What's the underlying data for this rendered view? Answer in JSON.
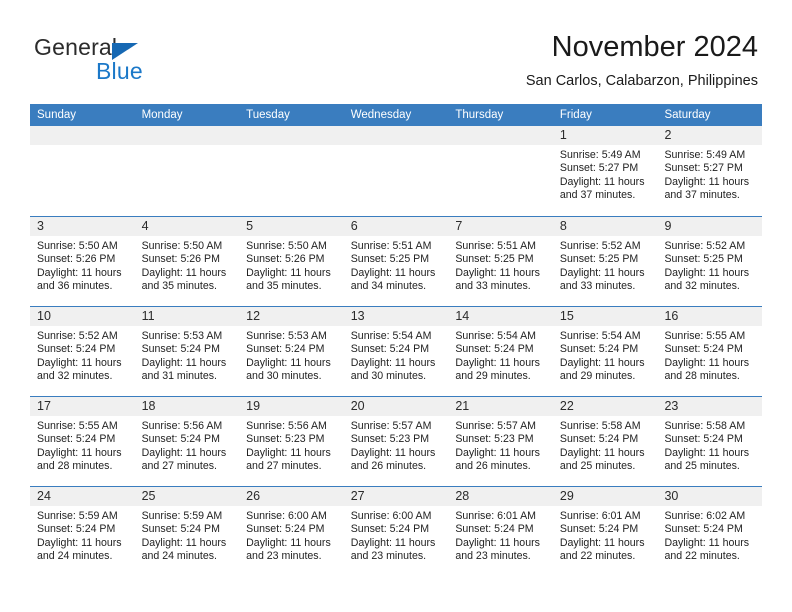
{
  "brand": {
    "name_top": "General",
    "name_bottom": "Blue",
    "accent_color": "#1b78c8",
    "triangle_color": "#1668b3"
  },
  "header": {
    "title": "November 2024",
    "subtitle": "San Carlos, Calabarzon, Philippines"
  },
  "calendar": {
    "header_bg": "#3a7dbf",
    "daynum_bg": "#f0f0f0",
    "weekdays": [
      "Sunday",
      "Monday",
      "Tuesday",
      "Wednesday",
      "Thursday",
      "Friday",
      "Saturday"
    ],
    "weeks": [
      [
        {
          "day": "",
          "sunrise": "",
          "sunset": "",
          "daylight": ""
        },
        {
          "day": "",
          "sunrise": "",
          "sunset": "",
          "daylight": ""
        },
        {
          "day": "",
          "sunrise": "",
          "sunset": "",
          "daylight": ""
        },
        {
          "day": "",
          "sunrise": "",
          "sunset": "",
          "daylight": ""
        },
        {
          "day": "",
          "sunrise": "",
          "sunset": "",
          "daylight": ""
        },
        {
          "day": "1",
          "sunrise": "Sunrise: 5:49 AM",
          "sunset": "Sunset: 5:27 PM",
          "daylight": "Daylight: 11 hours and 37 minutes."
        },
        {
          "day": "2",
          "sunrise": "Sunrise: 5:49 AM",
          "sunset": "Sunset: 5:27 PM",
          "daylight": "Daylight: 11 hours and 37 minutes."
        }
      ],
      [
        {
          "day": "3",
          "sunrise": "Sunrise: 5:50 AM",
          "sunset": "Sunset: 5:26 PM",
          "daylight": "Daylight: 11 hours and 36 minutes."
        },
        {
          "day": "4",
          "sunrise": "Sunrise: 5:50 AM",
          "sunset": "Sunset: 5:26 PM",
          "daylight": "Daylight: 11 hours and 35 minutes."
        },
        {
          "day": "5",
          "sunrise": "Sunrise: 5:50 AM",
          "sunset": "Sunset: 5:26 PM",
          "daylight": "Daylight: 11 hours and 35 minutes."
        },
        {
          "day": "6",
          "sunrise": "Sunrise: 5:51 AM",
          "sunset": "Sunset: 5:25 PM",
          "daylight": "Daylight: 11 hours and 34 minutes."
        },
        {
          "day": "7",
          "sunrise": "Sunrise: 5:51 AM",
          "sunset": "Sunset: 5:25 PM",
          "daylight": "Daylight: 11 hours and 33 minutes."
        },
        {
          "day": "8",
          "sunrise": "Sunrise: 5:52 AM",
          "sunset": "Sunset: 5:25 PM",
          "daylight": "Daylight: 11 hours and 33 minutes."
        },
        {
          "day": "9",
          "sunrise": "Sunrise: 5:52 AM",
          "sunset": "Sunset: 5:25 PM",
          "daylight": "Daylight: 11 hours and 32 minutes."
        }
      ],
      [
        {
          "day": "10",
          "sunrise": "Sunrise: 5:52 AM",
          "sunset": "Sunset: 5:24 PM",
          "daylight": "Daylight: 11 hours and 32 minutes."
        },
        {
          "day": "11",
          "sunrise": "Sunrise: 5:53 AM",
          "sunset": "Sunset: 5:24 PM",
          "daylight": "Daylight: 11 hours and 31 minutes."
        },
        {
          "day": "12",
          "sunrise": "Sunrise: 5:53 AM",
          "sunset": "Sunset: 5:24 PM",
          "daylight": "Daylight: 11 hours and 30 minutes."
        },
        {
          "day": "13",
          "sunrise": "Sunrise: 5:54 AM",
          "sunset": "Sunset: 5:24 PM",
          "daylight": "Daylight: 11 hours and 30 minutes."
        },
        {
          "day": "14",
          "sunrise": "Sunrise: 5:54 AM",
          "sunset": "Sunset: 5:24 PM",
          "daylight": "Daylight: 11 hours and 29 minutes."
        },
        {
          "day": "15",
          "sunrise": "Sunrise: 5:54 AM",
          "sunset": "Sunset: 5:24 PM",
          "daylight": "Daylight: 11 hours and 29 minutes."
        },
        {
          "day": "16",
          "sunrise": "Sunrise: 5:55 AM",
          "sunset": "Sunset: 5:24 PM",
          "daylight": "Daylight: 11 hours and 28 minutes."
        }
      ],
      [
        {
          "day": "17",
          "sunrise": "Sunrise: 5:55 AM",
          "sunset": "Sunset: 5:24 PM",
          "daylight": "Daylight: 11 hours and 28 minutes."
        },
        {
          "day": "18",
          "sunrise": "Sunrise: 5:56 AM",
          "sunset": "Sunset: 5:24 PM",
          "daylight": "Daylight: 11 hours and 27 minutes."
        },
        {
          "day": "19",
          "sunrise": "Sunrise: 5:56 AM",
          "sunset": "Sunset: 5:23 PM",
          "daylight": "Daylight: 11 hours and 27 minutes."
        },
        {
          "day": "20",
          "sunrise": "Sunrise: 5:57 AM",
          "sunset": "Sunset: 5:23 PM",
          "daylight": "Daylight: 11 hours and 26 minutes."
        },
        {
          "day": "21",
          "sunrise": "Sunrise: 5:57 AM",
          "sunset": "Sunset: 5:23 PM",
          "daylight": "Daylight: 11 hours and 26 minutes."
        },
        {
          "day": "22",
          "sunrise": "Sunrise: 5:58 AM",
          "sunset": "Sunset: 5:24 PM",
          "daylight": "Daylight: 11 hours and 25 minutes."
        },
        {
          "day": "23",
          "sunrise": "Sunrise: 5:58 AM",
          "sunset": "Sunset: 5:24 PM",
          "daylight": "Daylight: 11 hours and 25 minutes."
        }
      ],
      [
        {
          "day": "24",
          "sunrise": "Sunrise: 5:59 AM",
          "sunset": "Sunset: 5:24 PM",
          "daylight": "Daylight: 11 hours and 24 minutes."
        },
        {
          "day": "25",
          "sunrise": "Sunrise: 5:59 AM",
          "sunset": "Sunset: 5:24 PM",
          "daylight": "Daylight: 11 hours and 24 minutes."
        },
        {
          "day": "26",
          "sunrise": "Sunrise: 6:00 AM",
          "sunset": "Sunset: 5:24 PM",
          "daylight": "Daylight: 11 hours and 23 minutes."
        },
        {
          "day": "27",
          "sunrise": "Sunrise: 6:00 AM",
          "sunset": "Sunset: 5:24 PM",
          "daylight": "Daylight: 11 hours and 23 minutes."
        },
        {
          "day": "28",
          "sunrise": "Sunrise: 6:01 AM",
          "sunset": "Sunset: 5:24 PM",
          "daylight": "Daylight: 11 hours and 23 minutes."
        },
        {
          "day": "29",
          "sunrise": "Sunrise: 6:01 AM",
          "sunset": "Sunset: 5:24 PM",
          "daylight": "Daylight: 11 hours and 22 minutes."
        },
        {
          "day": "30",
          "sunrise": "Sunrise: 6:02 AM",
          "sunset": "Sunset: 5:24 PM",
          "daylight": "Daylight: 11 hours and 22 minutes."
        }
      ]
    ]
  }
}
